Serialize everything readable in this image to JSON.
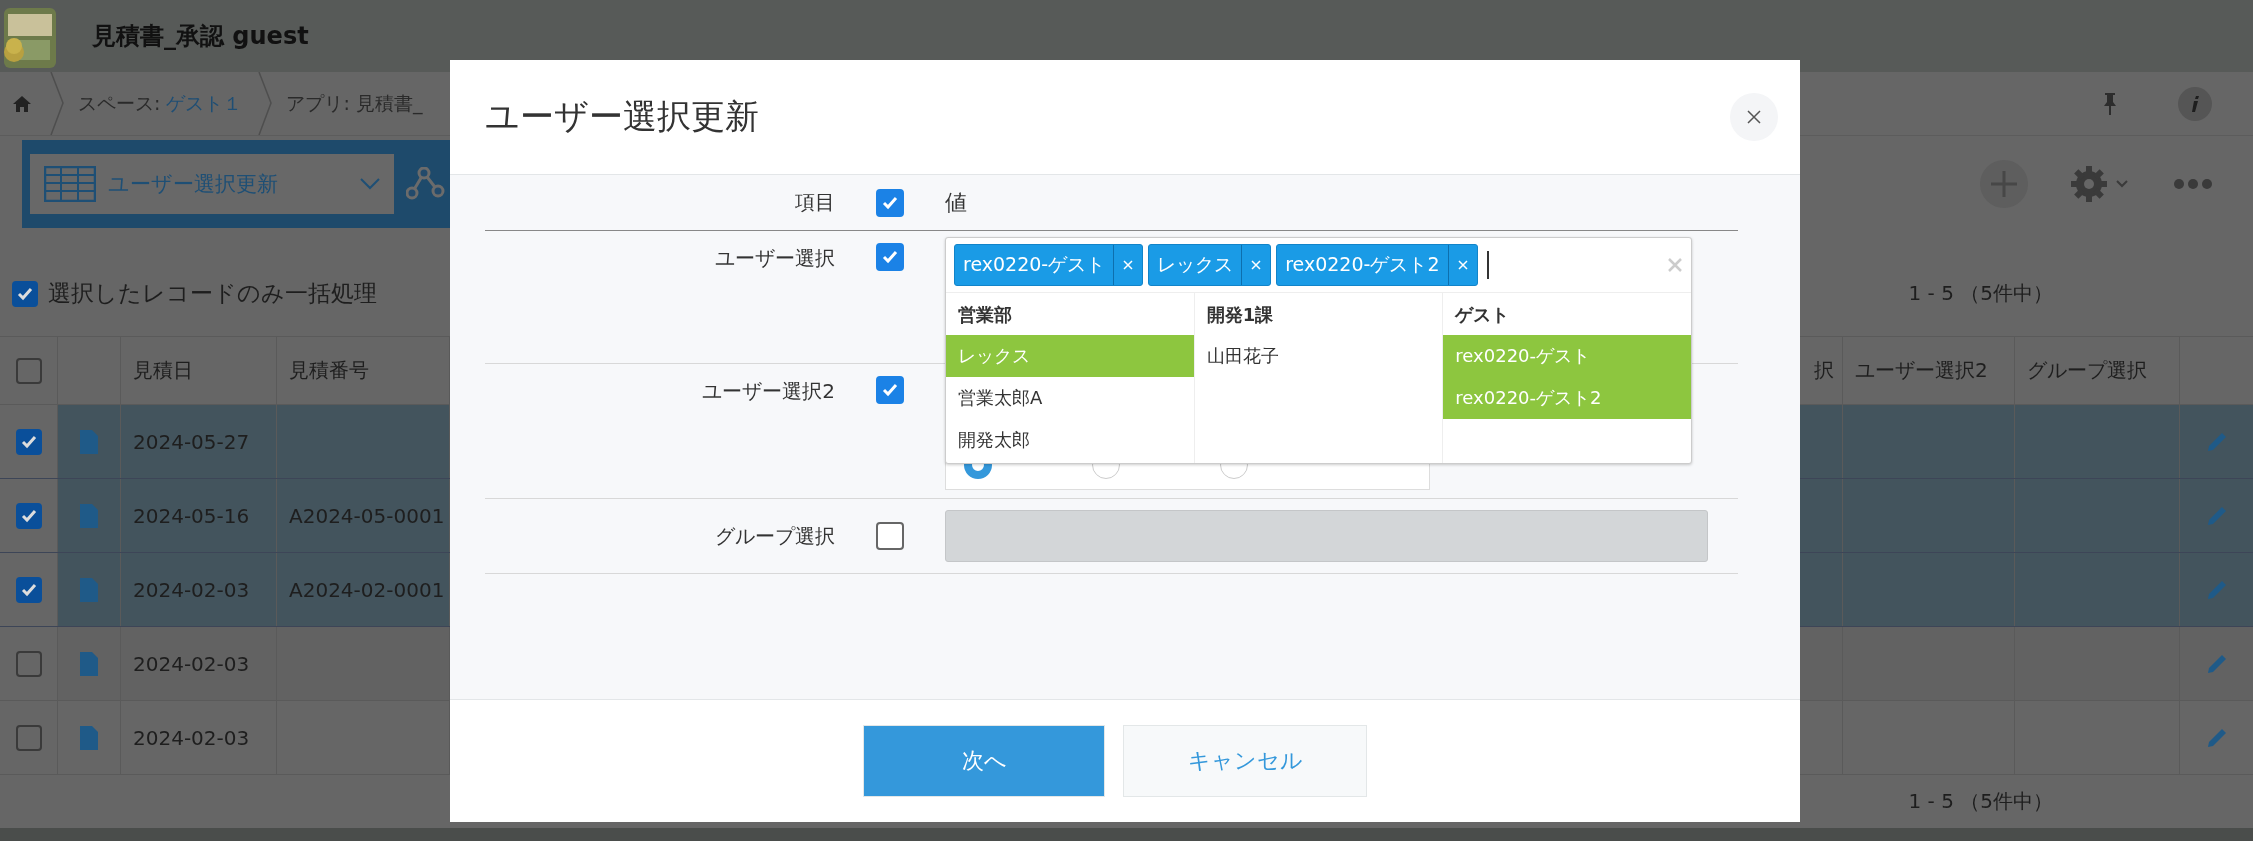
{
  "header": {
    "title": "見積書_承認 guest"
  },
  "breadcrumb": [
    {
      "text": "スペース: ",
      "link": "ゲスト１"
    },
    {
      "text": "アプリ: 見積書_"
    }
  ],
  "view_selector": {
    "value": "ユーザー選択更新"
  },
  "bulk_option": {
    "label": "選択したレコードのみ一括処理",
    "checked": true
  },
  "pagination_top": "1 - 5 （5件中）",
  "table": {
    "header_checked": false,
    "columns_left": [
      "見積日",
      "見積番号"
    ],
    "columns_right": [
      "択",
      "ユーザー選択2",
      "グループ選択"
    ],
    "rows": [
      {
        "selected": true,
        "date": "2024-05-27"
      },
      {
        "selected": true,
        "date": "2024-05-16",
        "number": "A2024-05-0001"
      },
      {
        "selected": true,
        "date": "2024-02-03",
        "number": "A2024-02-0001"
      },
      {
        "selected": false,
        "date": "2024-02-03"
      },
      {
        "selected": false,
        "date": "2024-02-03"
      }
    ]
  },
  "pagination_bottom": "1 - 5 （5件中）",
  "dialog": {
    "title": "ユーザー選択更新",
    "header_row": {
      "label": "項目",
      "checked": true,
      "value_heading": "値"
    },
    "fields": [
      {
        "kind": "user_picker",
        "label": "ユーザー選択",
        "checked": true,
        "tags": [
          "rex0220-ゲスト",
          "レックス",
          "rex0220-ゲスト2"
        ],
        "dropdown": [
          {
            "heading": "営業部",
            "items": [
              {
                "name": "レックス",
                "selected": true
              },
              {
                "name": "営業太郎A",
                "selected": false
              },
              {
                "name": "開発太郎",
                "selected": false
              }
            ]
          },
          {
            "heading": "開発1課",
            "items": [
              {
                "name": "山田花子",
                "selected": false
              }
            ]
          },
          {
            "heading": "ゲスト",
            "items": [
              {
                "name": "rex0220-ゲスト",
                "selected": true
              },
              {
                "name": "rex0220-ゲスト2",
                "selected": true
              }
            ]
          }
        ]
      },
      {
        "kind": "radio_group",
        "label": "ユーザー選択2",
        "checked": true,
        "radios": [
          {
            "selected": true
          },
          {
            "selected": false
          },
          {
            "selected": false
          }
        ]
      },
      {
        "kind": "disabled_field",
        "label": "グループ選択",
        "checked": false
      }
    ],
    "buttons": {
      "next": "次へ",
      "cancel": "キャンセル"
    }
  }
}
